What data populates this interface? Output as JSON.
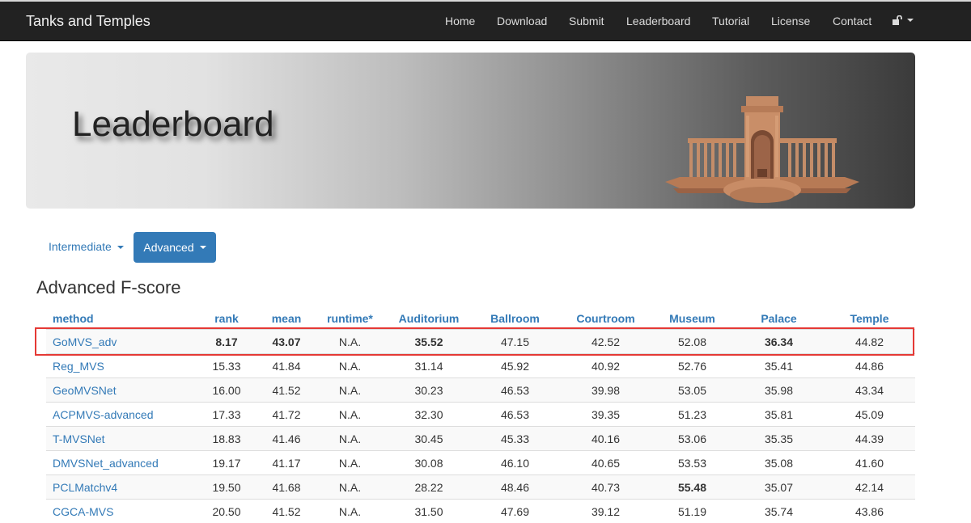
{
  "navbar": {
    "brand": "Tanks and Temples",
    "links": [
      "Home",
      "Download",
      "Submit",
      "Leaderboard",
      "Tutorial",
      "License",
      "Contact"
    ],
    "lock_icon": "unlock-icon"
  },
  "banner": {
    "title": "Leaderboard",
    "image": "temple-model-illustration"
  },
  "tabs": {
    "intermediate": "Intermediate",
    "advanced": "Advanced"
  },
  "section_title": "Advanced F-score",
  "colors": {
    "link": "#337ab7",
    "navbar": "#222222",
    "highlight_border": "#e53935"
  },
  "table": {
    "headers": [
      "method",
      "rank",
      "mean",
      "runtime*",
      "Auditorium",
      "Ballroom",
      "Courtroom",
      "Museum",
      "Palace",
      "Temple"
    ],
    "rows": [
      {
        "cells": [
          "GoMVS_adv",
          "8.17",
          "43.07",
          "N.A.",
          "35.52",
          "47.15",
          "42.52",
          "52.08",
          "36.34",
          "44.82"
        ],
        "bold": [
          1,
          2,
          4,
          8
        ],
        "highlighted": true
      },
      {
        "cells": [
          "Reg_MVS",
          "15.33",
          "41.84",
          "N.A.",
          "31.14",
          "45.92",
          "40.92",
          "52.76",
          "35.41",
          "44.86"
        ],
        "bold": []
      },
      {
        "cells": [
          "GeoMVSNet",
          "16.00",
          "41.52",
          "N.A.",
          "30.23",
          "46.53",
          "39.98",
          "53.05",
          "35.98",
          "43.34"
        ],
        "bold": []
      },
      {
        "cells": [
          "ACPMVS-advanced",
          "17.33",
          "41.72",
          "N.A.",
          "32.30",
          "46.53",
          "39.35",
          "51.23",
          "35.81",
          "45.09"
        ],
        "bold": []
      },
      {
        "cells": [
          "T-MVSNet",
          "18.83",
          "41.46",
          "N.A.",
          "30.45",
          "45.33",
          "40.16",
          "53.06",
          "35.35",
          "44.39"
        ],
        "bold": []
      },
      {
        "cells": [
          "DMVSNet_advanced",
          "19.17",
          "41.17",
          "N.A.",
          "30.08",
          "46.10",
          "40.65",
          "53.53",
          "35.08",
          "41.60"
        ],
        "bold": []
      },
      {
        "cells": [
          "PCLMatchv4",
          "19.50",
          "41.68",
          "N.A.",
          "28.22",
          "48.46",
          "40.73",
          "55.48",
          "35.07",
          "42.14"
        ],
        "bold": [
          7
        ]
      },
      {
        "cells": [
          "CGCA-MVS",
          "20.50",
          "41.52",
          "N.A.",
          "31.50",
          "47.69",
          "39.12",
          "51.19",
          "35.74",
          "43.86"
        ],
        "bold": []
      }
    ]
  }
}
